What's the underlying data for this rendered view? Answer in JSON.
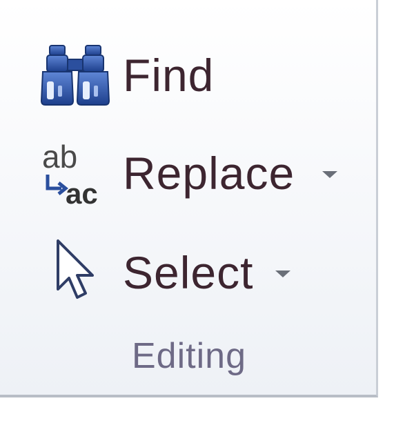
{
  "ribbon_group": {
    "title": "Editing",
    "commands": {
      "find": {
        "label": "Find",
        "icon": "binoculars-icon"
      },
      "replace": {
        "label": "Replace",
        "icon": "replace-ab-ac-icon",
        "has_dropdown": true,
        "icon_text_from": "ab",
        "icon_text_to": "ac"
      },
      "select": {
        "label": "Select",
        "icon": "cursor-arrow-icon",
        "has_dropdown": true
      }
    }
  },
  "colors": {
    "label_text": "#3d2530",
    "group_label_text": "#6e6a86",
    "icon_blue": "#2b4f9e",
    "replace_green": "#1f8a2e",
    "dropdown_arrow": "#6a6f78"
  }
}
